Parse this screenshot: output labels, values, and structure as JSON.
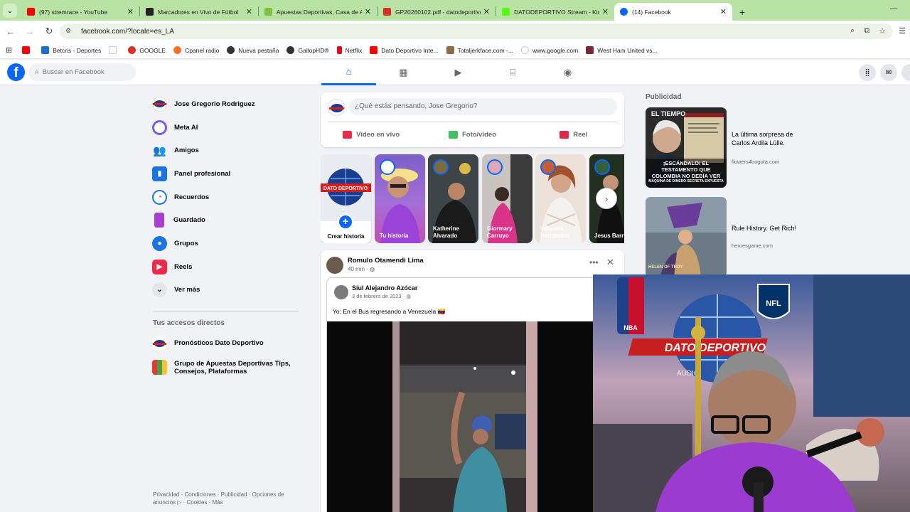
{
  "browser": {
    "tabs": [
      {
        "title": "(97) stremrace - YouTube",
        "color": "#ff0000"
      },
      {
        "title": "Marcadores en Vivo de Fútbol",
        "color": "#222222"
      },
      {
        "title": "Apuestas Deportivas, Casa de A",
        "color": "#7cc142"
      },
      {
        "title": "GP20260102.pdf - datodeportivo",
        "color": "#d93025"
      },
      {
        "title": "DATODEPORTIVO Stream - Kick",
        "color": "#53fc18"
      },
      {
        "title": "(14) Facebook",
        "color": "#0866ff"
      }
    ],
    "url": "facebook.com/?locale=es_LA",
    "bookmarks": [
      {
        "label": "",
        "color": "#ff0000"
      },
      {
        "label": "Betcris - Deportes",
        "color": "#1a6fd1"
      },
      {
        "label": "",
        "color": "#ffffff"
      },
      {
        "label": "GOOGLE",
        "color": "#d93025"
      },
      {
        "label": "Cpanel radio",
        "color": "#ff6c2c"
      },
      {
        "label": "Nueva pestaña",
        "color": "#333333"
      },
      {
        "label": "GallopHD®",
        "color": "#333333"
      },
      {
        "label": "Netflix",
        "color": "#e50914"
      },
      {
        "label": "Dato Deportivo Inte...",
        "color": "#ff0000"
      },
      {
        "label": "Totaljerkface.com -...",
        "color": "#8b6b4a"
      },
      {
        "label": "www.google.com",
        "color": "#ffffff"
      },
      {
        "label": "West Ham United vs...",
        "color": "#7a263a"
      }
    ]
  },
  "facebook": {
    "search_placeholder": "Buscar en Facebook",
    "sidebar": {
      "items": [
        {
          "label": "Jose Gregorio Rodriguez"
        },
        {
          "label": "Meta AI"
        },
        {
          "label": "Amigos"
        },
        {
          "label": "Panel profesional"
        },
        {
          "label": "Recuerdos"
        },
        {
          "label": "Guardado"
        },
        {
          "label": "Grupos"
        },
        {
          "label": "Reels"
        },
        {
          "label": "Ver más"
        }
      ],
      "shortcuts_heading": "Tus accesos directos",
      "shortcuts": [
        {
          "label": "Pronósticos Dato Deportivo"
        },
        {
          "label": "Grupo de Apuestas Deportivas Tips, Consejos, Plataformas"
        }
      ],
      "footer": "Privacidad · Condiciones · Publicidad · Opciones de anuncios ▷ · Cookies · Más"
    },
    "composer": {
      "placeholder": "¿Qué estás pensando, Jose Gregorio?",
      "actions": [
        "Video en vivo",
        "Foto/video",
        "Reel"
      ]
    },
    "stories": {
      "create_label": "Crear historia",
      "logo_text": "DATO DEPORTIVO",
      "items": [
        {
          "name": "Tu historia"
        },
        {
          "name": "Katherine Alvarado"
        },
        {
          "name": "Giormary Carruyo"
        },
        {
          "name": "Vanessa Hernandez"
        },
        {
          "name": "Jesus Barrio"
        }
      ]
    },
    "post": {
      "author": "Romulo Otamendi Lima",
      "time": "40 min · ",
      "shared_author": "Siul Alejandro Azócar",
      "shared_date": "3 de febrero de 2023 · ",
      "shared_text": "Yo: En el Bus regresando a Venezuela 🇻🇪"
    },
    "ads": {
      "heading": "Publicidad",
      "items": [
        {
          "title": "La última sorpresa de Carlos Ardila Lülle.",
          "url": "flowers4bogota.com",
          "img_top": "EL TIEMPO",
          "img_bottom": "¡ESCÁNDALO! EL TESTAMENTO QUE COLOMBIA NO DEBÍA VER",
          "img_sub": "MÁQUINA DE DINERO SECRETA EXPUESTA"
        },
        {
          "title": "Rule History. Get Rich!",
          "url": "heroesgame.com",
          "img_bottom": "HELEN OF TROY"
        }
      ]
    }
  },
  "webcam": {
    "overlay_text": "DATO DEPORTIVO",
    "sub_text": "AUDIO",
    "badges": [
      "NBA",
      "NFL"
    ]
  }
}
